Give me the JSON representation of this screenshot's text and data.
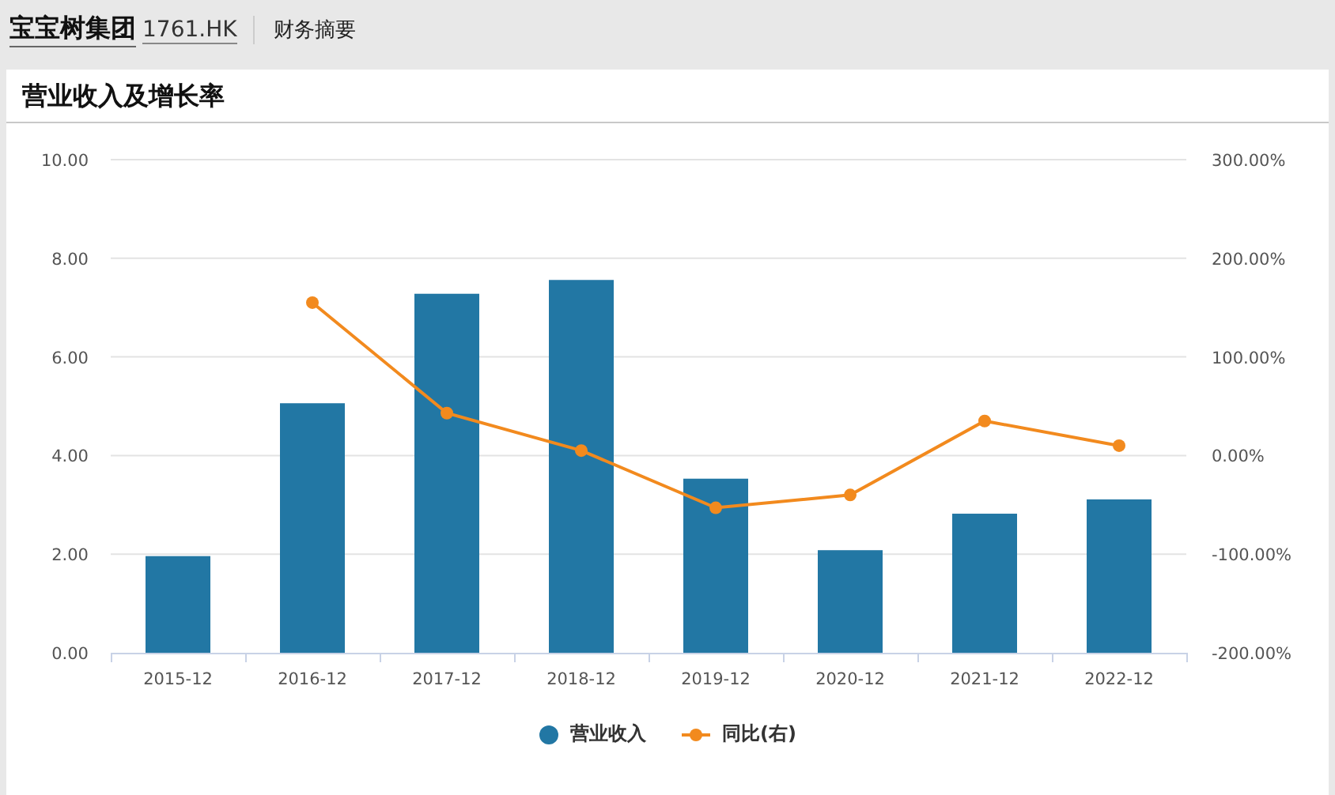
{
  "header": {
    "company": "宝宝树集团",
    "code": "1761.HK",
    "section": "财务摘要"
  },
  "card": {
    "title": "营业收入及增长率",
    "chart_data": {
      "type": "bar",
      "categories": [
        "2015-12",
        "2016-12",
        "2017-12",
        "2018-12",
        "2019-12",
        "2020-12",
        "2021-12",
        "2022-12"
      ],
      "series": [
        {
          "name": "营业收入",
          "color": "#2277a4",
          "values": [
            1.96,
            5.06,
            7.28,
            7.56,
            3.53,
            2.08,
            2.82,
            3.11
          ]
        },
        {
          "name": "同比(右)",
          "type": "line",
          "axis": "y2",
          "marker": "circle",
          "color": "#f28a1e",
          "values": [
            null,
            155,
            43,
            5,
            -53,
            -40,
            35,
            10
          ]
        }
      ],
      "grid": true,
      "ylim": [
        0,
        10
      ],
      "yticks": [
        {
          "value": 0,
          "label": "0.00"
        },
        {
          "value": 2,
          "label": "2.00"
        },
        {
          "value": 4,
          "label": "4.00"
        },
        {
          "value": 6,
          "label": "6.00"
        },
        {
          "value": 8,
          "label": "8.00"
        },
        {
          "value": 10,
          "label": "10.00"
        }
      ],
      "y2lim": [
        -200,
        300
      ],
      "y2ticks": [
        {
          "value": -200,
          "label": "-200.00%"
        },
        {
          "value": -100,
          "label": "-100.00%"
        },
        {
          "value": 0,
          "label": "0.00%"
        },
        {
          "value": 100,
          "label": "100.00%"
        },
        {
          "value": 200,
          "label": "200.00%"
        },
        {
          "value": 300,
          "label": "300.00%"
        }
      ]
    }
  }
}
